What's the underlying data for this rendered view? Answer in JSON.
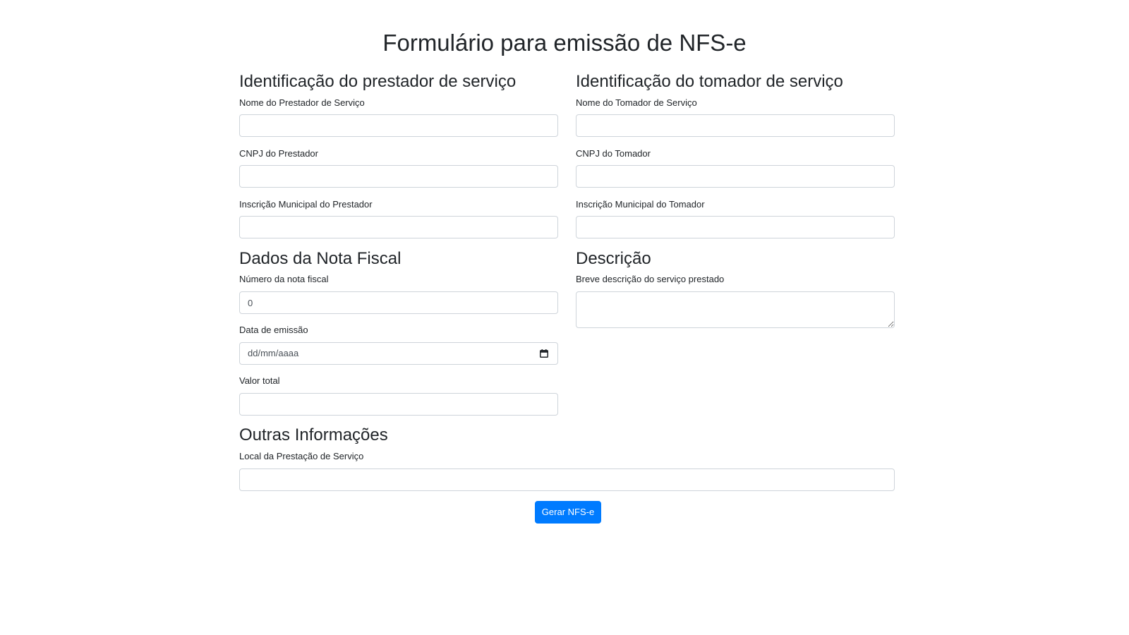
{
  "page": {
    "title": "Formulário para emissão de NFS-e"
  },
  "prestador": {
    "heading": "Identificação do prestador de serviço",
    "nome_label": "Nome do Prestador de Serviço",
    "nome_value": "",
    "cnpj_label": "CNPJ do Prestador",
    "cnpj_value": "",
    "inscricao_label": "Inscrição Municipal do Prestador",
    "inscricao_value": ""
  },
  "tomador": {
    "heading": "Identificação do tomador de serviço",
    "nome_label": "Nome do Tomador de Serviço",
    "nome_value": "",
    "cnpj_label": "CNPJ do Tomador",
    "cnpj_value": "",
    "inscricao_label": "Inscrição Municipal do Tomador",
    "inscricao_value": ""
  },
  "nota": {
    "heading": "Dados da Nota Fiscal",
    "numero_label": "Número da nota fiscal",
    "numero_value": "0",
    "data_label": "Data de emissão",
    "data_placeholder": "dd/mm/aaaa",
    "valor_label": "Valor total",
    "valor_value": ""
  },
  "descricao": {
    "heading": "Descrição",
    "breve_label": "Breve descrição do serviço prestado",
    "breve_value": ""
  },
  "outras": {
    "heading": "Outras Informações",
    "local_label": "Local da Prestação de Serviço",
    "local_value": ""
  },
  "actions": {
    "submit_label": "Gerar NFS-e"
  },
  "icons": {
    "date": "calendar-icon"
  },
  "colors": {
    "primary": "#007bff",
    "text": "#212529",
    "input_border": "#ced4da"
  }
}
